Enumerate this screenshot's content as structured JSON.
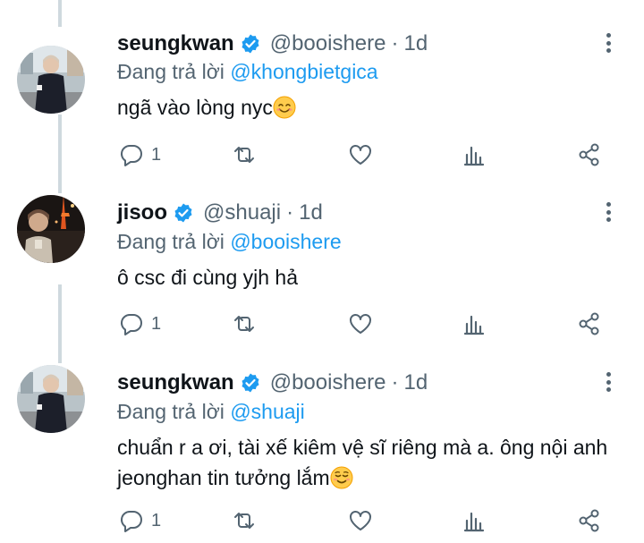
{
  "tweets": [
    {
      "name": "seungkwan",
      "handle": "@booishere",
      "separator": "·",
      "time": "1d",
      "reply_prefix": "Đang trả lời",
      "reply_to": "@khongbietgica",
      "text": "ngã vào lòng nyc",
      "emoji": "smiling-face",
      "reply_count": "1",
      "avatar": "person-in-black-outfit"
    },
    {
      "name": "jisoo",
      "handle": "@shuaji",
      "separator": "·",
      "time": "1d",
      "reply_prefix": "Đang trả lời",
      "reply_to": "@booishere",
      "text": "ô csc đi cùng yjh hả",
      "emoji": "",
      "reply_count": "1",
      "avatar": "person-night-tower"
    },
    {
      "name": "seungkwan",
      "handle": "@booishere",
      "separator": "·",
      "time": "1d",
      "reply_prefix": "Đang trả lời",
      "reply_to": "@shuaji",
      "text": "chuẩn r a ơi, tài xế kiêm vệ sĩ riêng mà a. ông nội anh jeonghan tin tưởng lắm",
      "emoji": "relieved-face",
      "reply_count": "1",
      "avatar": "person-in-black-outfit"
    }
  ],
  "colors": {
    "link": "#1d9bf0",
    "secondary_text": "#536471",
    "primary_text": "#0f1419",
    "verified": "#1d9bf0",
    "thread_line": "#cfd9de"
  },
  "icons": [
    "verified-badge-icon",
    "more-vertical-icon",
    "reply-icon",
    "retweet-icon",
    "like-icon",
    "analytics-icon",
    "share-icon"
  ]
}
